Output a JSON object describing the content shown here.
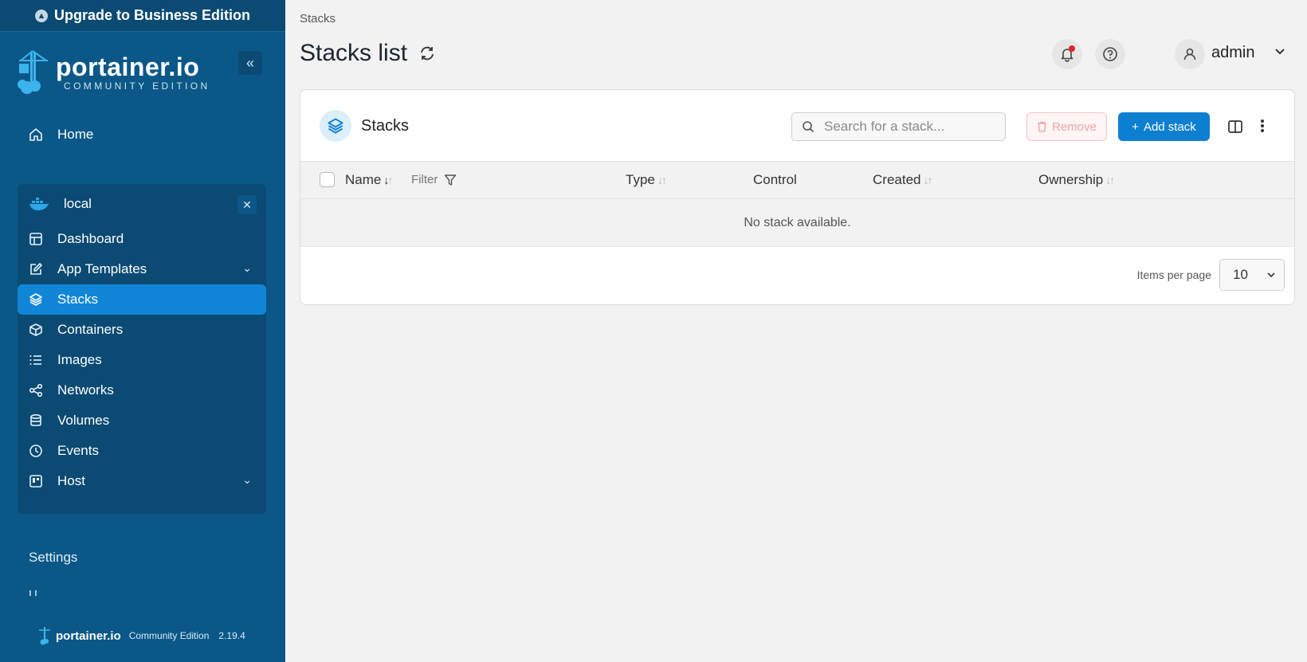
{
  "sidebar": {
    "upgrade_label": "Upgrade to Business Edition",
    "brand": {
      "name": "portainer.io",
      "edition": "COMMUNITY EDITION"
    },
    "home_label": "Home",
    "environment": {
      "name": "local",
      "items": [
        {
          "label": "Dashboard",
          "icon": "dashboard-icon"
        },
        {
          "label": "App Templates",
          "icon": "edit-icon",
          "expandable": true
        },
        {
          "label": "Stacks",
          "icon": "layers-icon",
          "active": true
        },
        {
          "label": "Containers",
          "icon": "box-icon"
        },
        {
          "label": "Images",
          "icon": "list-icon"
        },
        {
          "label": "Networks",
          "icon": "share-icon"
        },
        {
          "label": "Volumes",
          "icon": "database-icon"
        },
        {
          "label": "Events",
          "icon": "clock-icon"
        },
        {
          "label": "Host",
          "icon": "host-icon",
          "expandable": true
        }
      ]
    },
    "settings_label": "Settings",
    "cut_item_label": "U",
    "footer": {
      "brand": "portainer.io",
      "edition": "Community Edition",
      "version": "2.19.4"
    }
  },
  "header": {
    "breadcrumb": "Stacks",
    "title": "Stacks list",
    "user": "admin"
  },
  "card": {
    "title": "Stacks",
    "search_placeholder": "Search for a stack...",
    "remove_label": "Remove",
    "add_label": "Add stack",
    "columns": [
      "Name",
      "Type",
      "Control",
      "Created",
      "Ownership"
    ],
    "filter_label": "Filter",
    "empty_message": "No stack available.",
    "items_per_page_label": "Items per page",
    "items_per_page": "10"
  },
  "colors": {
    "sidebar": "#0b5888",
    "active": "#1186d6",
    "primary": "#0d7fd1"
  }
}
